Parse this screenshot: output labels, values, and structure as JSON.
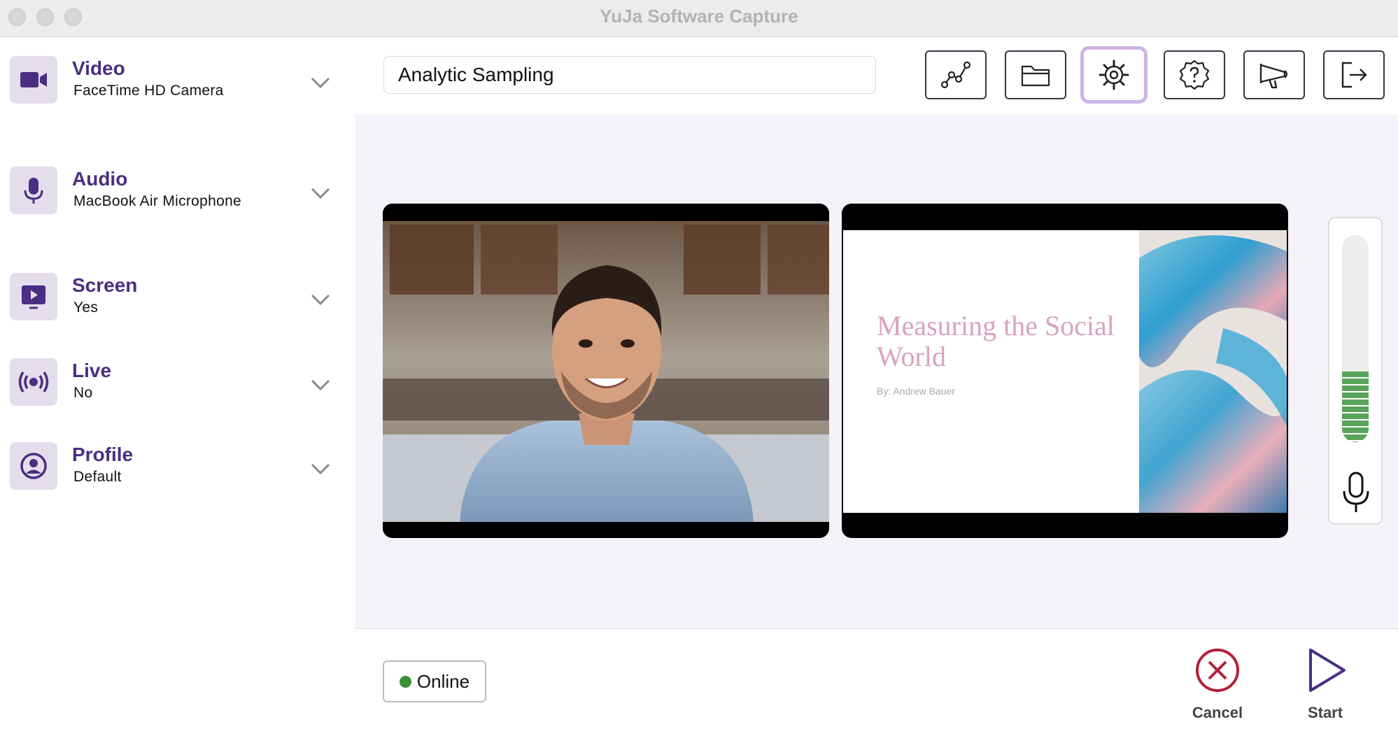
{
  "window": {
    "title": "YuJa Software Capture"
  },
  "sidebar": {
    "items": [
      {
        "title": "Video",
        "value": "FaceTime HD Camera",
        "icon": "video-camera-icon"
      },
      {
        "title": "Audio",
        "value": "MacBook Air Microphone",
        "icon": "microphone-icon"
      },
      {
        "title": "Screen",
        "value": "Yes",
        "icon": "screen-play-icon"
      },
      {
        "title": "Live",
        "value": "No",
        "icon": "broadcast-icon"
      },
      {
        "title": "Profile",
        "value": "Default",
        "icon": "user-profile-icon"
      }
    ]
  },
  "header": {
    "session_title": "Analytic Sampling",
    "tools": [
      {
        "name": "analytics",
        "icon": "analytics-chart-icon"
      },
      {
        "name": "folder",
        "icon": "folder-icon"
      },
      {
        "name": "settings",
        "icon": "gear-icon",
        "active": true
      },
      {
        "name": "help",
        "icon": "help-icon"
      },
      {
        "name": "announcements",
        "icon": "megaphone-icon"
      },
      {
        "name": "logout",
        "icon": "logout-icon"
      }
    ]
  },
  "preview": {
    "slide_title": "Measuring the Social World",
    "slide_author": "By: Andrew Bauer",
    "audio_level": 0.34
  },
  "footer": {
    "status": "Online",
    "cancel_label": "Cancel",
    "start_label": "Start"
  },
  "colors": {
    "accent": "#4a2e82",
    "icon_bg": "#e4deec",
    "cancel": "#b3203a",
    "status_online": "#3a8f3a",
    "meter": "#5aa35a"
  }
}
